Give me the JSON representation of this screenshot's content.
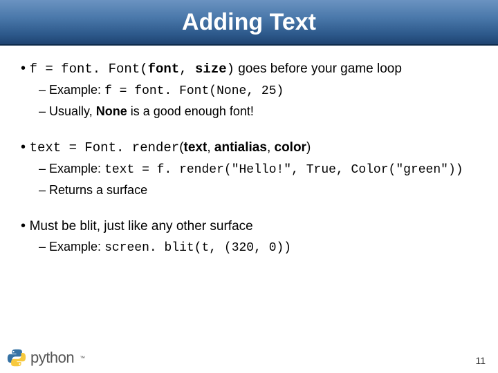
{
  "header": {
    "title": "Adding Text"
  },
  "bullets": {
    "b1": {
      "code1": "f = font. Font(",
      "bold1": "font",
      "sep1": ", ",
      "bold2": "size",
      "code2": ")",
      "tail": " goes before your game loop",
      "sub": {
        "s1_label": "Example: ",
        "s1_code": "f = font. Font(None, 25)",
        "s2_pre": "Usually, ",
        "s2_bold": "None",
        "s2_post": " is a good enough font!"
      }
    },
    "b2": {
      "code1": "text = Font. render",
      "open": "(",
      "bold1": "text",
      "sep1": ", ",
      "bold2": "antialias",
      "sep2": ", ",
      "bold3": "color",
      "close": ")",
      "sub": {
        "s1_label": "Example: ",
        "s1_code": "text = f. render(\"Hello!\", True, Color(\"green\"))",
        "s2": "Returns a surface"
      }
    },
    "b3": {
      "text": "Must be blit, just like any other surface",
      "sub": {
        "s1_label": "Example: ",
        "s1_code": "screen. blit(t, (320, 0))"
      }
    }
  },
  "footer": {
    "brand": "python",
    "tm": "™"
  },
  "page": "11"
}
